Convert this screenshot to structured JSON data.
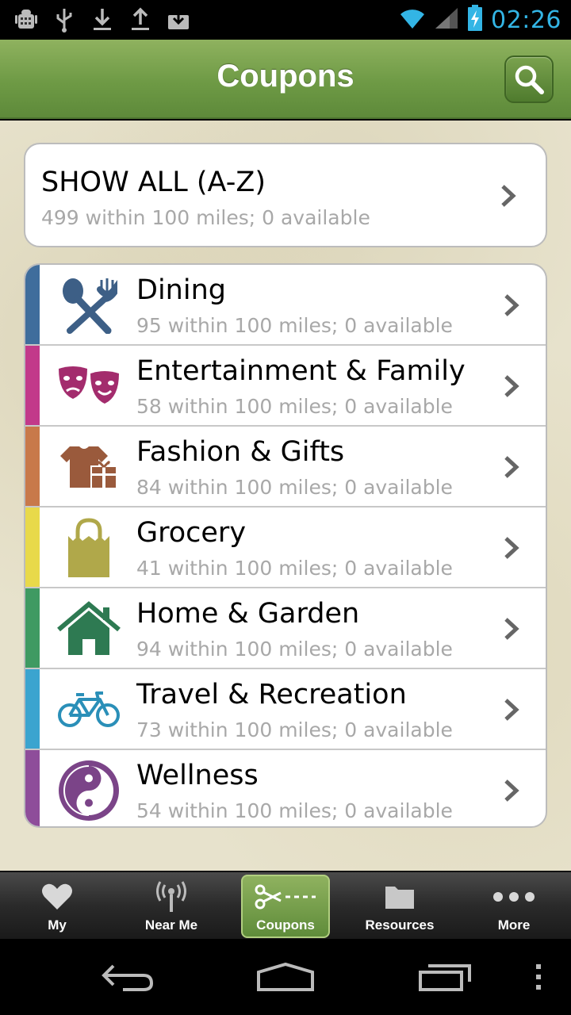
{
  "status_bar": {
    "time": "02:26",
    "left_icons": [
      "android-debug-icon",
      "usb-icon",
      "download-icon",
      "upload-icon",
      "download-box-icon"
    ],
    "right_icons": [
      "wifi-icon",
      "signal-icon",
      "battery-charging-icon"
    ]
  },
  "header": {
    "title": "Coupons",
    "search_icon": "search-icon"
  },
  "show_all": {
    "title": "SHOW ALL (A-Z)",
    "subtitle": "499 within 100 miles; 0 available"
  },
  "categories": [
    {
      "label": "Dining",
      "subtitle": "95 within 100 miles; 0 available",
      "icon": "fork-knife-icon",
      "color": "#3f6d9c"
    },
    {
      "label": "Entertainment & Family",
      "subtitle": "58 within 100 miles; 0 available",
      "icon": "theater-masks-icon",
      "color": "#c2398a"
    },
    {
      "label": "Fashion & Gifts",
      "subtitle": "84 within 100 miles; 0 available",
      "icon": "shirt-gift-icon",
      "color": "#c8794a"
    },
    {
      "label": "Grocery",
      "subtitle": "41 within 100 miles; 0 available",
      "icon": "grocery-bag-icon",
      "color": "#e8d94a"
    },
    {
      "label": "Home & Garden",
      "subtitle": "94 within 100 miles; 0 available",
      "icon": "house-icon",
      "color": "#3f9a62"
    },
    {
      "label": "Travel & Recreation",
      "subtitle": "73 within 100 miles; 0 available",
      "icon": "bicycle-icon",
      "color": "#3ba4cf"
    },
    {
      "label": "Wellness",
      "subtitle": "54 within 100 miles; 0 available",
      "icon": "yin-yang-icon",
      "color": "#8e4d9a"
    }
  ],
  "tabs": [
    {
      "label": "My",
      "icon": "heart-icon"
    },
    {
      "label": "Near Me",
      "icon": "antenna-icon"
    },
    {
      "label": "Coupons",
      "icon": "scissors-icon",
      "active": true
    },
    {
      "label": "Resources",
      "icon": "folder-icon"
    },
    {
      "label": "More",
      "icon": "more-dots-icon"
    }
  ],
  "nav_bar": [
    "back-icon",
    "home-icon",
    "recent-apps-icon",
    "menu-icon"
  ]
}
